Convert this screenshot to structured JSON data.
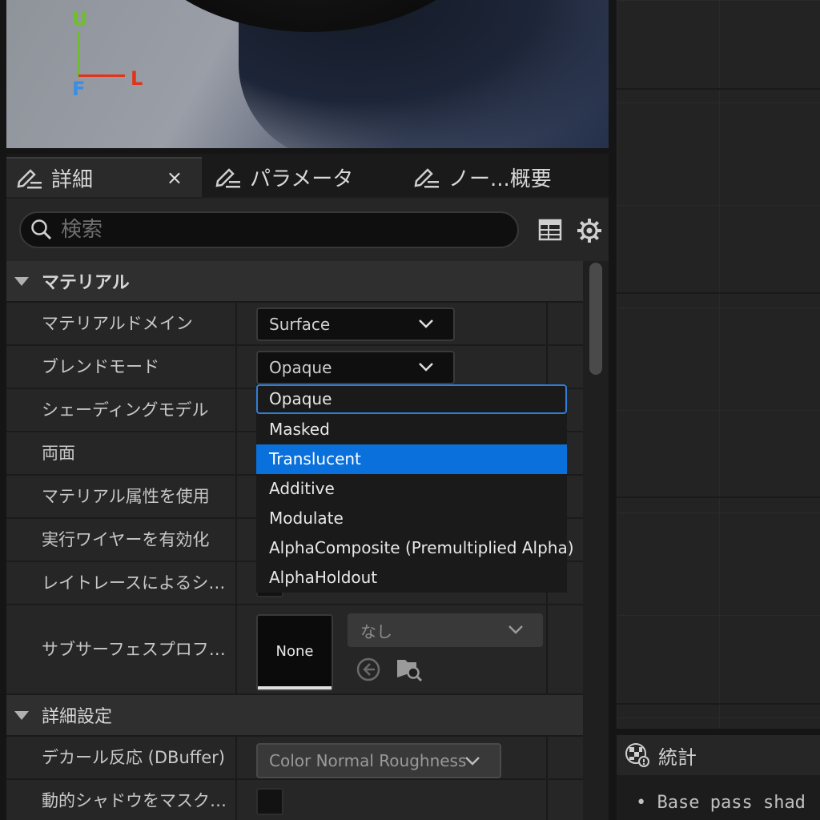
{
  "viewport": {
    "axes": {
      "up": "U",
      "left": "L",
      "forward": "F"
    }
  },
  "tabs": [
    {
      "label": "詳細",
      "icon": "pencil-list-icon",
      "active": true,
      "close": "×"
    },
    {
      "label": "パラメータ",
      "icon": "pencil-list-icon",
      "active": false
    },
    {
      "label": "ノー...概要",
      "icon": "pencil-list-icon",
      "active": false
    }
  ],
  "search": {
    "placeholder": "検索",
    "value": ""
  },
  "toolbar": {
    "table_icon": "table-icon",
    "settings_icon": "gear-icon"
  },
  "sections": {
    "material": {
      "label": "マテリアル",
      "rows": [
        {
          "name": "マテリアルドメイン",
          "value": "Surface"
        },
        {
          "name": "ブレンドモード",
          "value": "Opaque"
        },
        {
          "name": "シェーディングモデル"
        },
        {
          "name": "両面"
        },
        {
          "name": "マテリアル属性を使用"
        },
        {
          "name": "実行ワイヤーを有効化"
        },
        {
          "name": "レイトレースによるシャド..."
        },
        {
          "name": "サブサーフェスプロファイ..."
        }
      ],
      "subsurface": {
        "thumb_label": "None",
        "combo_value": "なし"
      }
    },
    "advanced": {
      "label": "詳細設定",
      "rows": [
        {
          "name": "デカール反応 (DBuffer)",
          "value": "Color Normal Roughness"
        },
        {
          "name": "動的シャドウをマスク済..."
        }
      ]
    }
  },
  "blend_dropdown": {
    "current": "Opaque",
    "highlighted": "Translucent",
    "options": [
      "Opaque",
      "Masked",
      "Translucent",
      "Additive",
      "Modulate",
      "AlphaComposite (Premultiplied Alpha)",
      "AlphaHoldout"
    ]
  },
  "stats": {
    "title": "統計",
    "icon": "stats-checker-icon",
    "lines": [
      "Base pass shad"
    ]
  },
  "colors": {
    "accent": "#0a70dc",
    "axis_up": "#6fbf2a",
    "axis_left": "#e0341a",
    "axis_forward": "#3a8ee6"
  }
}
